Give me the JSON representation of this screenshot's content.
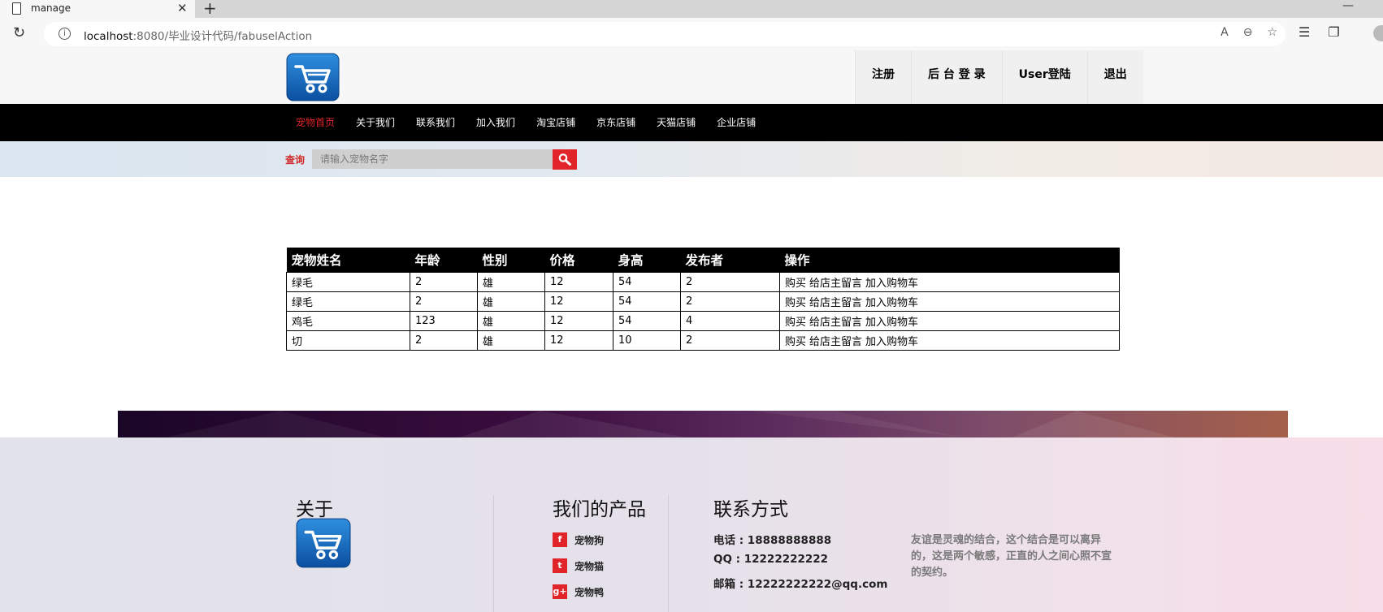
{
  "browser": {
    "tab_title": "manage",
    "tab_close": "✕",
    "new_tab": "+",
    "window_min": "—",
    "url_host": "localhost",
    "url_rest": ":8080/毕业设计代码/fabuselAction"
  },
  "header": {
    "nav": [
      "注册",
      "后 台 登 录",
      "User登陆",
      "退出"
    ]
  },
  "mainnav": {
    "links": [
      "宠物首页",
      "关于我们",
      "联系我们",
      "加入我们",
      "淘宝店铺",
      "京东店铺",
      "天猫店铺",
      "企业店铺"
    ],
    "active_index": 0
  },
  "search": {
    "label": "查询",
    "placeholder": "请输入宠物名字"
  },
  "table": {
    "headers": [
      "宠物姓名",
      "年龄",
      "性别",
      "价格",
      "身高",
      "发布者",
      "操作"
    ],
    "rows": [
      [
        "绿毛",
        "2",
        "雄",
        "12",
        "54",
        "2"
      ],
      [
        "绿毛",
        "2",
        "雄",
        "12",
        "54",
        "2"
      ],
      [
        "鸡毛",
        "123",
        "雄",
        "12",
        "54",
        "4"
      ],
      [
        "切",
        "2",
        "雄",
        "12",
        "10",
        "2"
      ]
    ],
    "actions": [
      "购买",
      "给店主留言",
      "加入购物车"
    ]
  },
  "footer": {
    "about_title": "关于",
    "products_title": "我们的产品",
    "products": [
      {
        "icon": "facebook-icon",
        "glyph": "f",
        "label": "宠物狗"
      },
      {
        "icon": "twitter-icon",
        "glyph": "t",
        "label": "宠物猫"
      },
      {
        "icon": "google-plus-icon",
        "glyph": "g+",
        "label": "宠物鸭"
      }
    ],
    "contact_title": "联系方式",
    "phone": "电话 : 18888888888",
    "qq": "QQ : 12222222222",
    "email": "邮箱 : 12222222222@qq.com",
    "motto": "友谊是灵魂的结合，这个结合是可以离异的，这是两个敏感，正直的人之间心照不宣的契约。"
  },
  "colors": {
    "accent": "#e0242a",
    "nav_bg": "#000000",
    "logo_blue": "#1565c0"
  }
}
